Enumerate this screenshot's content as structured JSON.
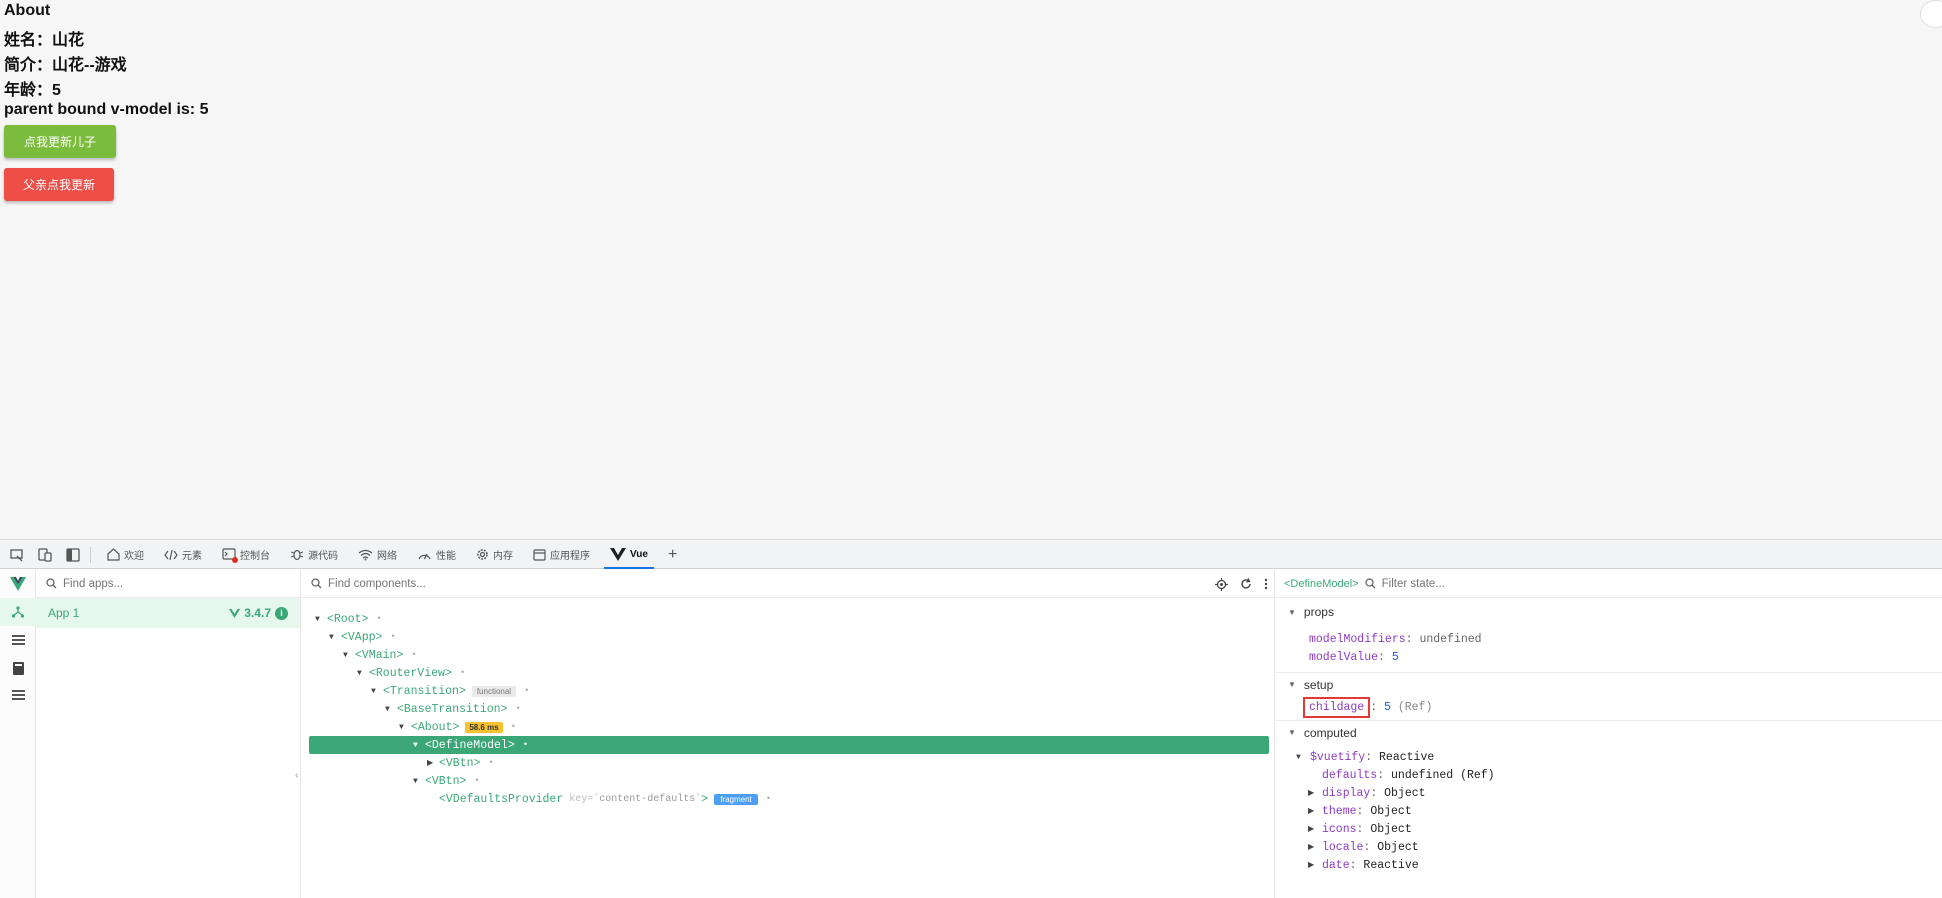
{
  "page": {
    "lines": [
      "About",
      "姓名：山花",
      "简介：山花--游戏",
      "年龄：5",
      "parent bound v-model is: 5"
    ],
    "btn_child": "点我更新儿子",
    "btn_parent": "父亲点我更新"
  },
  "devtools_tabs": [
    {
      "icon": "home-icon",
      "label": "欢迎"
    },
    {
      "icon": "code-icon",
      "label": "元素"
    },
    {
      "icon": "console-icon",
      "label": "控制台"
    },
    {
      "icon": "bug-icon",
      "label": "源代码"
    },
    {
      "icon": "wifi-icon",
      "label": "网络"
    },
    {
      "icon": "gauge-icon",
      "label": "性能"
    },
    {
      "icon": "gear-icon",
      "label": "内存"
    },
    {
      "icon": "window-icon",
      "label": "应用程序"
    },
    {
      "icon": "vue-icon",
      "label": "Vue"
    }
  ],
  "apps": {
    "search_placeholder": "Find apps...",
    "app_name": "App 1",
    "vue_version": "3.4.7"
  },
  "tree": {
    "search_placeholder": "Find components...",
    "nodes": {
      "root": "<Root>",
      "vapp": "<VApp>",
      "vmain": "<VMain>",
      "routerview": "<RouterView>",
      "transition": "<Transition>",
      "transition_tag": "functional",
      "basetransition": "<BaseTransition>",
      "about": "<About>",
      "about_tag": "58.6 ms",
      "definemodel": "<DefineModel>",
      "vbtn1": "<VBtn>",
      "vbtn2": "<VBtn>",
      "vdefaults": "<VDefaultsProvider",
      "vdefaults_key": "key=",
      "vdefaults_keyval": "`content-defaults`",
      "vdefaults_close": ">",
      "vdefaults_tag": "fragment"
    }
  },
  "state": {
    "crumb": "<DefineModel>",
    "filter_placeholder": "Filter state...",
    "props_title": "props",
    "props": [
      {
        "key": "modelModifiers",
        "value": "undefined"
      },
      {
        "key": "modelValue",
        "value": "5"
      }
    ],
    "setup_title": "setup",
    "setup": {
      "key": "childage",
      "value": "5",
      "note": "(Ref)"
    },
    "computed_title": "computed",
    "vuetify_key": "$vuetify",
    "vuetify_val": "Reactive",
    "defaults_key": "defaults",
    "defaults_val": "undefined",
    "defaults_note": "(Ref)",
    "computed_items": [
      {
        "key": "display",
        "value": "Object"
      },
      {
        "key": "theme",
        "value": "Object"
      },
      {
        "key": "icons",
        "value": "Object"
      },
      {
        "key": "locale",
        "value": "Object"
      },
      {
        "key": "date",
        "value": "Reactive"
      }
    ]
  }
}
